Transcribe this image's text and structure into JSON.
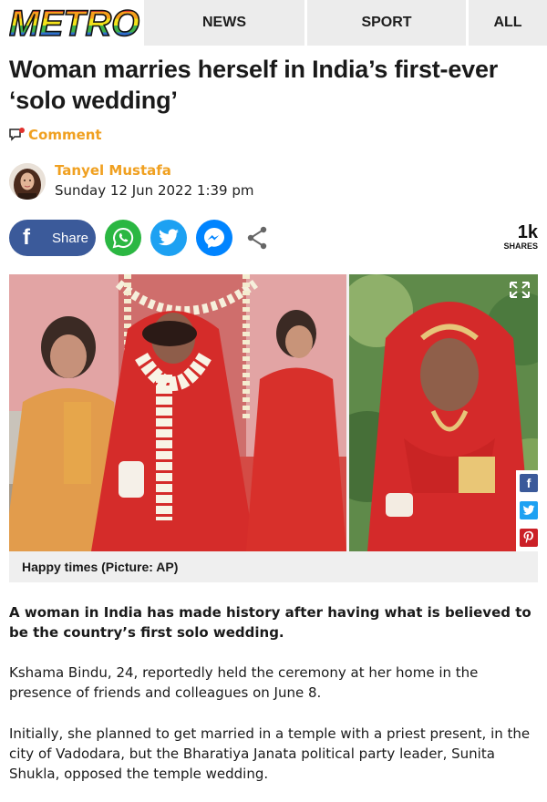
{
  "header": {
    "logo_text": "METRO",
    "nav": [
      "NEWS",
      "SPORT",
      "ALL"
    ]
  },
  "article": {
    "headline": "Woman marries herself in India’s first-ever ‘solo wedding’",
    "comment_label": "Comment",
    "author": "Tanyel Mustafa",
    "date": "Sunday 12 Jun 2022 1:39 pm",
    "share_label": "Share",
    "share_count": "1k",
    "share_count_label": "SHARES",
    "caption": "Happy times (Picture: AP)",
    "paragraphs": [
      "A woman in India has made history after having what is believed to be the country’s first solo wedding.",
      "Kshama Bindu, 24, reportedly held the ceremony at her home in the presence of friends and colleagues on June 8.",
      "Initially, she planned to get married in a temple with a priest present, in the city of Vadodara, but the Bharatiya Janata political party leader, Sunita Shukla, opposed the temple wedding."
    ]
  },
  "colors": {
    "accent": "#f0a020",
    "facebook": "#3b5a9a",
    "whatsapp": "#2bb742",
    "twitter": "#1da1f2",
    "messenger": "#0084ff",
    "pinterest": "#cb2027"
  },
  "icons": [
    "comment-icon",
    "facebook-icon",
    "whatsapp-icon",
    "twitter-icon",
    "messenger-icon",
    "share-icon",
    "expand-icon",
    "pinterest-icon"
  ]
}
